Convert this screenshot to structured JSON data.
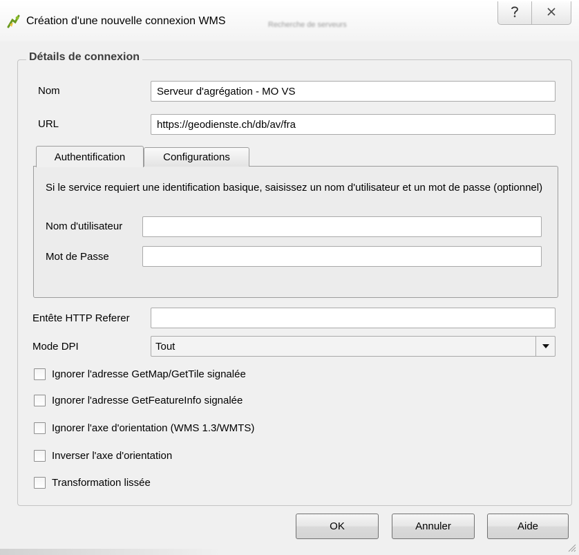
{
  "window": {
    "title": "Création d'une nouvelle connexion WMS",
    "title_ghost": "Recherche de serveurs",
    "help_icon": "question-mark-icon",
    "close_icon": "close-x-icon",
    "app_icon": "qgis-logo-icon"
  },
  "group": {
    "title": "Détails de connexion"
  },
  "fields": {
    "name_label": "Nom",
    "name_value": "Serveur d'agrégation - MO VS",
    "url_label": "URL",
    "url_value": "https://geodienste.ch/db/av/fra"
  },
  "tabs": [
    {
      "label": "Authentification",
      "active": true
    },
    {
      "label": "Configurations",
      "active": false
    }
  ],
  "auth": {
    "description": "Si le service requiert une identification basique, saisissez un nom d'utilisateur et un mot de passe (optionnel)",
    "username_label": "Nom d'utilisateur",
    "username_value": "",
    "password_label": "Mot de Passe",
    "password_value": ""
  },
  "referer": {
    "label": "Entête HTTP Referer",
    "value": ""
  },
  "dpi": {
    "label": "Mode DPI",
    "selected": "Tout"
  },
  "checkboxes": [
    {
      "label": "Ignorer l'adresse GetMap/GetTile signalée",
      "checked": false
    },
    {
      "label": "Ignorer l'adresse GetFeatureInfo signalée",
      "checked": false
    },
    {
      "label": "Ignorer l'axe d'orientation (WMS 1.3/WMTS)",
      "checked": false
    },
    {
      "label": "Inverser l'axe d'orientation",
      "checked": false
    },
    {
      "label": "Transformation lissée",
      "checked": false
    }
  ],
  "buttons": {
    "ok": "OK",
    "cancel": "Annuler",
    "help": "Aide"
  },
  "colors": {
    "background": "#f0f0f0",
    "border": "#a9a9a9"
  }
}
